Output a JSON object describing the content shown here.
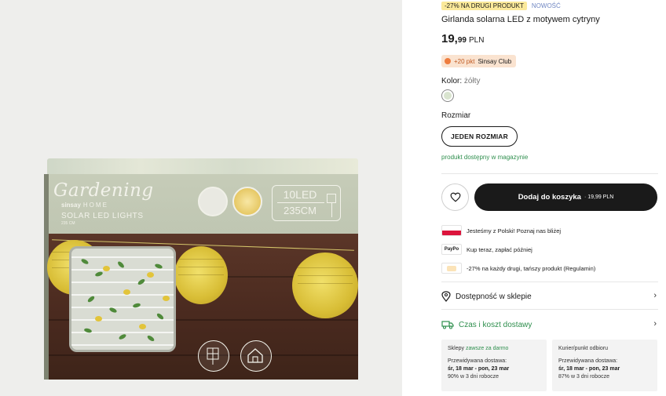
{
  "product_image": {
    "brand": "Gardening",
    "sub_brand": "sinsay",
    "sub_brand_home": "HOME",
    "product_line": "SOLAR LED LIGHTS",
    "length_small": "235 CM",
    "led_count": "10LED",
    "length": "235CM",
    "badge_white_label": "COOL WHITE",
    "badge_warm_label": "WARM WHITE"
  },
  "product": {
    "promo_tag": "-27% NA DRUGI PRODUKT",
    "new_tag": "NOWOŚĆ",
    "title": "Girlanda solarna LED z motywem cytryny",
    "price_main": "19,",
    "price_frac": "99",
    "currency": "PLN",
    "club_points": "+20 pkt",
    "club_name": "Sinsay Club",
    "color_label": "Kolor:",
    "color_value": "żółty",
    "size_label": "Rozmiar",
    "size_option": "JEDEN ROZMIAR",
    "availability": "produkt dostępny w magazynie",
    "add_to_cart_label": "Dodaj do koszyka",
    "add_to_cart_price": "· 19,99 PLN"
  },
  "info": {
    "poland": "Jesteśmy z Polski! Poznaj nas bliżej",
    "paypo_logo": "PayPo",
    "paypo": "Kup teraz, zapłać później",
    "promo": "-27% na każdy drugi, tańszy produkt (Regulamin)"
  },
  "links": {
    "store_availability": "Dostępność w sklepie",
    "delivery": "Czas i koszt dostawy"
  },
  "delivery": [
    {
      "title": "Sklepy",
      "free_label": "zawsze za darmo",
      "expected_label": "Przewidywana dostawa:",
      "dates": "śr, 18 mar - pon, 23 mar",
      "stat": "90% w 3 dni robocze"
    },
    {
      "title": "Kurier/punkt odbioru",
      "free_label": "",
      "expected_label": "Przewidywana dostawa:",
      "dates": "śr, 18 mar - pon, 23 mar",
      "stat": "87% w 3 dni robocze"
    }
  ],
  "icons": {
    "wishlist": "heart-icon",
    "store": "location-pin-icon",
    "delivery": "truck-icon",
    "chevron": "chevron-right-icon"
  },
  "colors": {
    "accent_green": "#2f8f4e",
    "button_dark": "#1a1a1a",
    "promo_yellow": "#fbe99a",
    "club_bg": "#fae3d0"
  }
}
